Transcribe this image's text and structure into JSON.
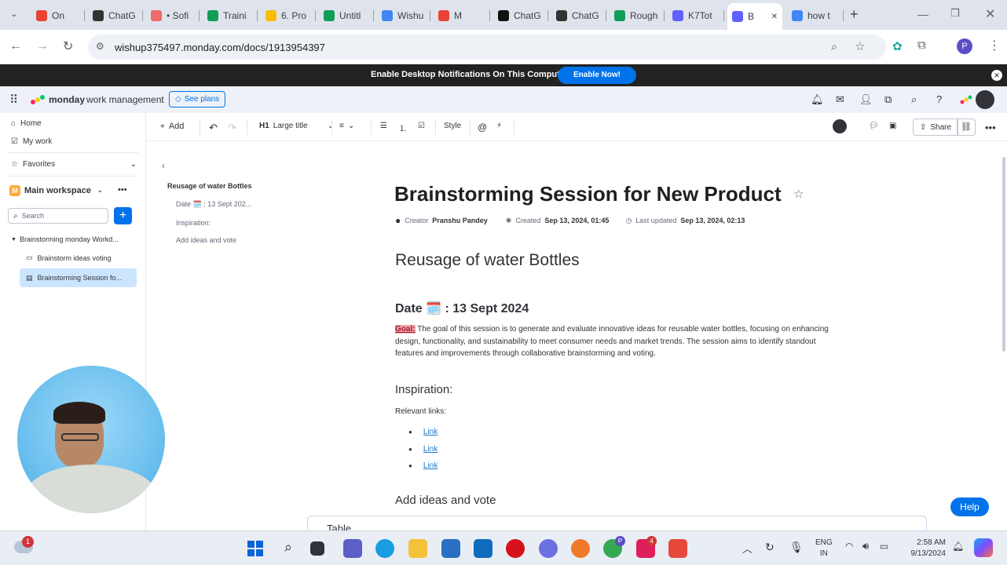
{
  "browser": {
    "tabs": [
      {
        "label": "On",
        "color": "#ea4335"
      },
      {
        "label": "ChatG",
        "color": "#333333"
      },
      {
        "label": "• Sofi",
        "color": "#f06a6a"
      },
      {
        "label": "Traini",
        "color": "#0f9d58"
      },
      {
        "label": "6. Pro",
        "color": "#fbbc04"
      },
      {
        "label": "Untitl",
        "color": "#0f9d58"
      },
      {
        "label": "Wishu",
        "color": "#4285f4"
      },
      {
        "label": "M",
        "color": "#ea4335"
      },
      {
        "label": "ChatG",
        "color": "#111111"
      },
      {
        "label": "ChatG",
        "color": "#333333"
      },
      {
        "label": "Rough",
        "color": "#0f9d58"
      },
      {
        "label": "K7Tot",
        "color": "#6161ff"
      },
      {
        "label": "B",
        "color": "#6161ff"
      },
      {
        "label": "how t",
        "color": "#4285f4"
      }
    ],
    "url": "wishup375497.monday.com/docs/1913954397",
    "profile_initial": "P"
  },
  "notification": {
    "message": "Enable Desktop Notifications On This Computer",
    "button": "Enable Now!"
  },
  "app": {
    "brand": "monday",
    "brand_sub": "work management",
    "see_plans": "See plans"
  },
  "sidebar": {
    "home": "Home",
    "my_work": "My work",
    "favorites": "Favorites",
    "workspace_initial": "M",
    "workspace": "Main workspace",
    "search_placeholder": "Search",
    "folder": "Brainstorming monday Workd...",
    "items": [
      "Brainstorm ideas voting",
      "Brainstorming Session fo..."
    ]
  },
  "toolbar": {
    "add": "Add",
    "heading": "Large title",
    "style": "Style",
    "share": "Share"
  },
  "outline": {
    "title": "Reusage of water Bottles",
    "items": [
      "Date 🗓️ : 13 Sept 202...",
      "Inspiration:",
      "Add ideas and vote"
    ]
  },
  "doc": {
    "title": "Brainstorming Session for New Product",
    "creator_label": "Creator",
    "creator": "Pranshu Pandey",
    "created_label": "Created",
    "created": "Sep 13, 2024, 01:45",
    "updated_label": "Last updated",
    "updated": "Sep 13, 2024, 02:13",
    "h1": "Reusage of water Bottles",
    "date_heading": "Date 🗓️ : 13 Sept 2024",
    "goal_label": "Goal:",
    "goal_text": "The goal of this session is to generate and evaluate innovative ideas for reusable water bottles, focusing on enhancing design, functionality, and sustainability to meet consumer needs and market trends. The session aims to identify standout features and improvements through collaborative brainstorming and voting.",
    "inspiration": "Inspiration:",
    "relevant_links": "Relevant links:",
    "links": [
      "Link",
      "Link",
      "Link"
    ],
    "add_ideas": "Add ideas and vote",
    "table_label": "Table"
  },
  "help": "Help",
  "taskbar": {
    "lang": "ENG",
    "region": "IN",
    "time": "2:58 AM",
    "date": "9/13/2024",
    "badge_weather": "1",
    "badge_chrome": "P",
    "badge_slack": "4"
  },
  "colors": {
    "accent": "#0073ea",
    "goal_highlight": "#f3a6ad",
    "notif_bg": "#222222"
  }
}
